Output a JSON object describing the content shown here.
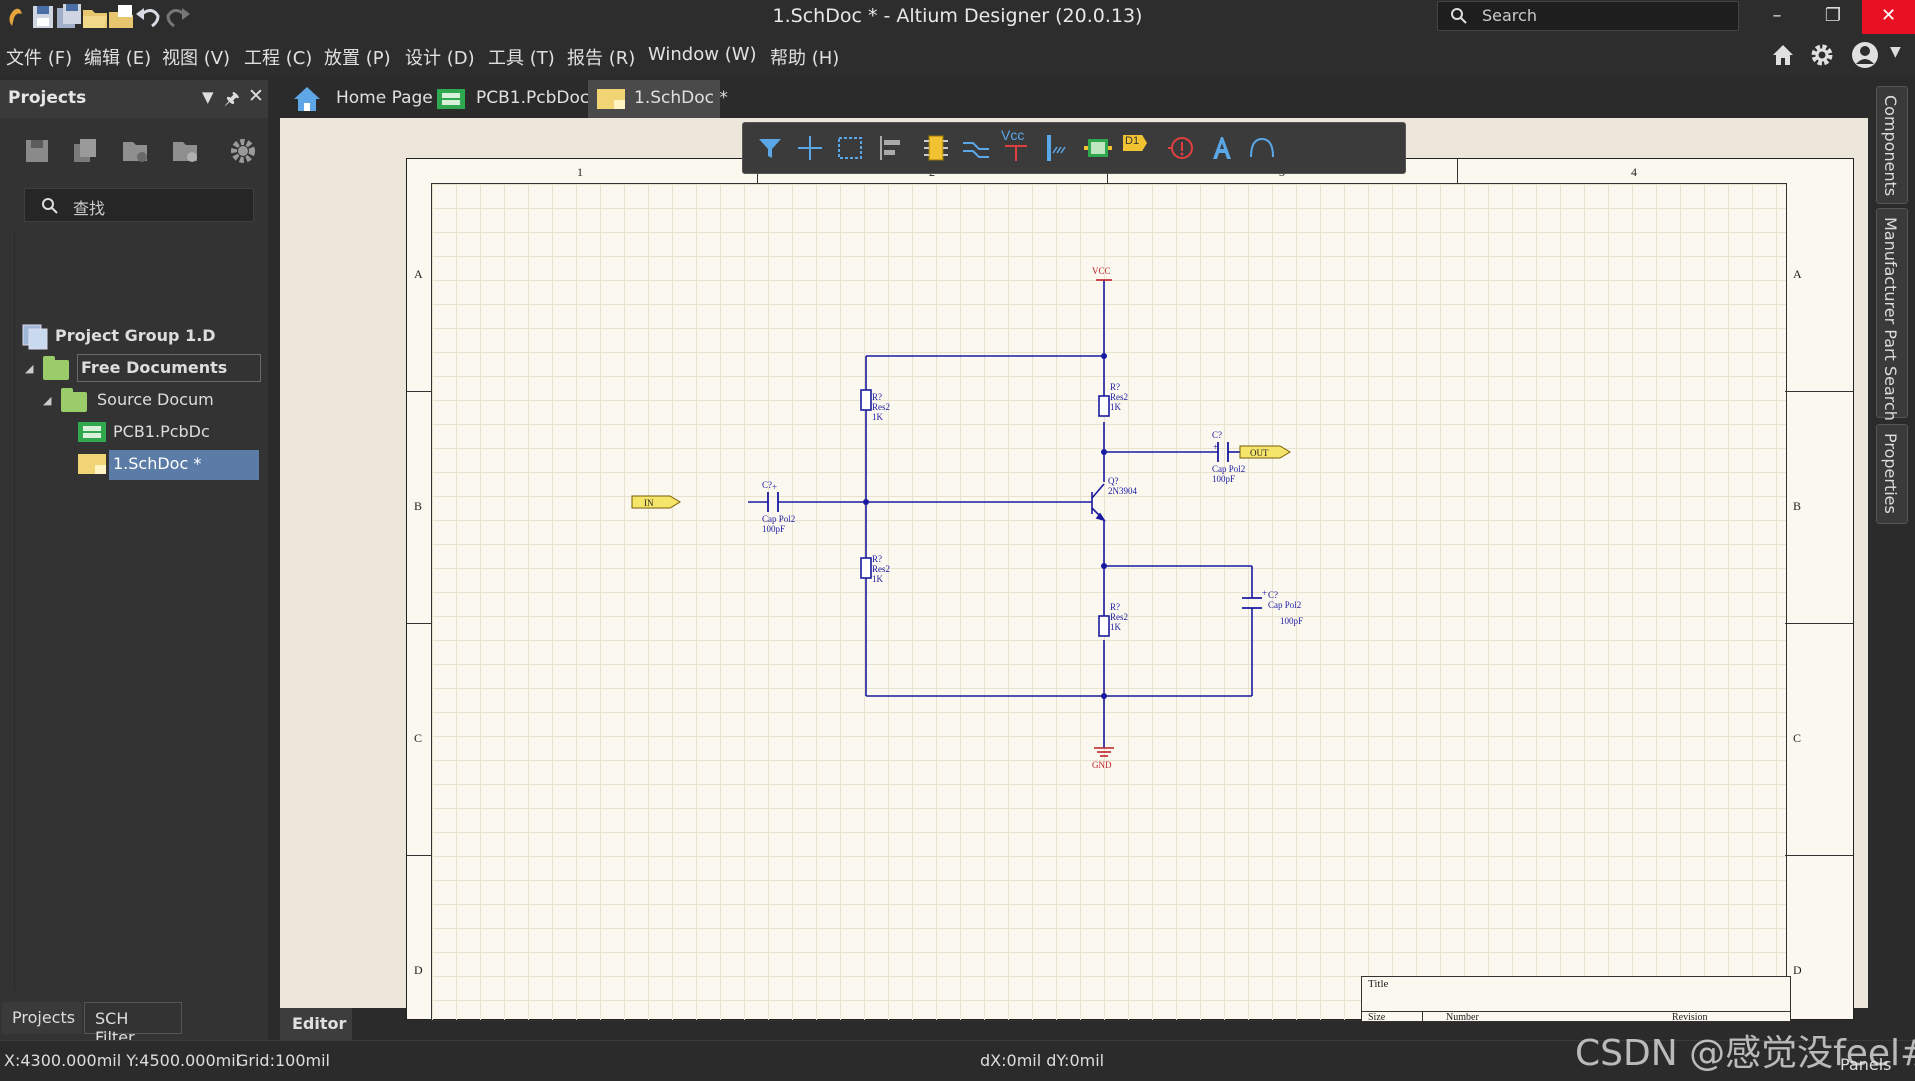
{
  "window": {
    "title": "1.SchDoc * - Altium Designer (20.0.13)",
    "search_placeholder": "Search"
  },
  "menu": [
    "文件 (F)",
    "编辑 (E)",
    "视图 (V)",
    "工程 (C)",
    "放置 (P)",
    "设计 (D)",
    "工具 (T)",
    "报告 (R)",
    "Window (W)",
    "帮助 (H)"
  ],
  "projects_panel": {
    "title": "Projects",
    "search_placeholder": "查找",
    "tree": [
      {
        "label": "Project Group 1.D",
        "level": 0
      },
      {
        "label": "Free Documents",
        "level": 1
      },
      {
        "label": "Source Docum",
        "level": 2
      },
      {
        "label": "PCB1.PcbDc",
        "level": 3
      },
      {
        "label": "1.SchDoc *",
        "level": 3
      }
    ],
    "bottom_tabs": [
      "Projects",
      "SCH Filter"
    ]
  },
  "doc_tabs": [
    {
      "label": "Home Page",
      "icon": "home-icon"
    },
    {
      "label": "PCB1.PcbDoc",
      "icon": "pcb-doc-icon"
    },
    {
      "label": "1.SchDoc *",
      "icon": "sch-doc-icon",
      "active": true
    }
  ],
  "right_panels": [
    "Components",
    "Manufacturer Part Search",
    "Properties"
  ],
  "sheet": {
    "columns": [
      "1",
      "2",
      "3",
      "4"
    ],
    "rows": [
      "A",
      "B",
      "C",
      "D"
    ],
    "title_block": {
      "title": "Title",
      "size": "Size",
      "number": "Number",
      "revision": "Revision"
    }
  },
  "schematic": {
    "power_vcc": "VCC",
    "power_gnd": "GND",
    "port_in": "IN",
    "port_out": "OUT",
    "r1": {
      "designator": "R?",
      "comment": "Res2",
      "value": "1K"
    },
    "r2": {
      "designator": "R?",
      "comment": "Res2",
      "value": "1K"
    },
    "r3": {
      "designator": "R?",
      "comment": "Res2",
      "value": "1K"
    },
    "r4": {
      "designator": "R?",
      "comment": "Res2",
      "value": "1K"
    },
    "c_in": {
      "designator": "C?",
      "comment": "Cap Pol2",
      "value": "100pF"
    },
    "c_out": {
      "designator": "C?",
      "comment": "Cap Pol2",
      "value": "100pF"
    },
    "c_e": {
      "designator": "C?",
      "comment": "Cap Pol2",
      "value": "100pF"
    },
    "q1": {
      "designator": "Q?",
      "comment": "2N3904"
    }
  },
  "toolbar_vcc_label": "Vcc",
  "toolbar_d1_label": "D1",
  "editor_tab": "Editor",
  "status": {
    "coords": "X:4300.000mil Y:4500.000mil",
    "grid": "Grid:100mil",
    "delta": "dX:0mil dY:0mil",
    "panels": "Panels"
  },
  "watermark": "CSDN @感觉没feel#",
  "colors": {
    "wire": "#1a1aa0",
    "power": "#c0202a",
    "port_fill": "#f5e56b",
    "selection": "#5a7ca6"
  }
}
